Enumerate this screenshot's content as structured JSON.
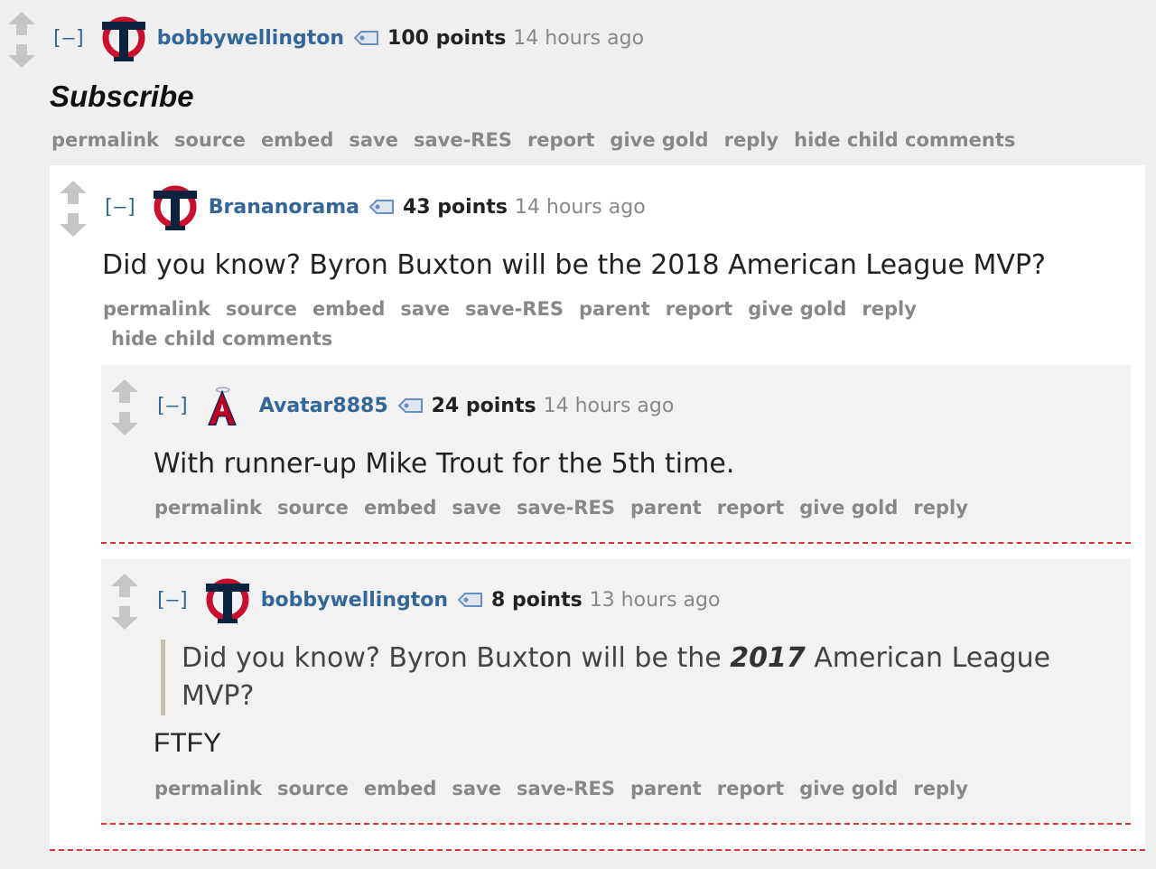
{
  "comments": [
    {
      "author": "bobbywellington",
      "score": "100 points",
      "time": "14 hours ago",
      "collapse": "[–]",
      "flair": "twins-logo-icon",
      "body": "Subscribe",
      "buttons": [
        "permalink",
        "source",
        "embed",
        "save",
        "save-RES",
        "report",
        "give gold",
        "reply",
        "hide child comments"
      ]
    },
    {
      "author": "Brananorama",
      "score": "43 points",
      "time": "14 hours ago",
      "collapse": "[–]",
      "flair": "twins-logo-icon",
      "body": "Did you know? Byron Buxton will be the 2018 American League MVP?",
      "buttons": [
        "permalink",
        "source",
        "embed",
        "save",
        "save-RES",
        "parent",
        "report",
        "give gold",
        "reply"
      ],
      "buttons_line2": "hide child comments"
    },
    {
      "author": "Avatar8885",
      "score": "24 points",
      "time": "14 hours ago",
      "collapse": "[–]",
      "flair": "angels-logo-icon",
      "body": "With runner-up Mike Trout for the 5th time.",
      "buttons": [
        "permalink",
        "source",
        "embed",
        "save",
        "save-RES",
        "parent",
        "report",
        "give gold",
        "reply"
      ]
    },
    {
      "author": "bobbywellington",
      "score": "8 points",
      "time": "13 hours ago",
      "collapse": "[–]",
      "flair": "twins-logo-icon",
      "quote_before": "Did you know? Byron Buxton will be the ",
      "quote_emph": "2017",
      "quote_after": " American League",
      "quote_line2": "MVP?",
      "body": "FTFY",
      "buttons": [
        "permalink",
        "source",
        "embed",
        "save",
        "save-RES",
        "parent",
        "report",
        "give gold",
        "reply"
      ]
    }
  ],
  "colors": {
    "author": "#336699",
    "button": "#888888",
    "dash": "#e03030",
    "panel_light": "#ffffff",
    "panel_gray": "#f2f2f2"
  }
}
